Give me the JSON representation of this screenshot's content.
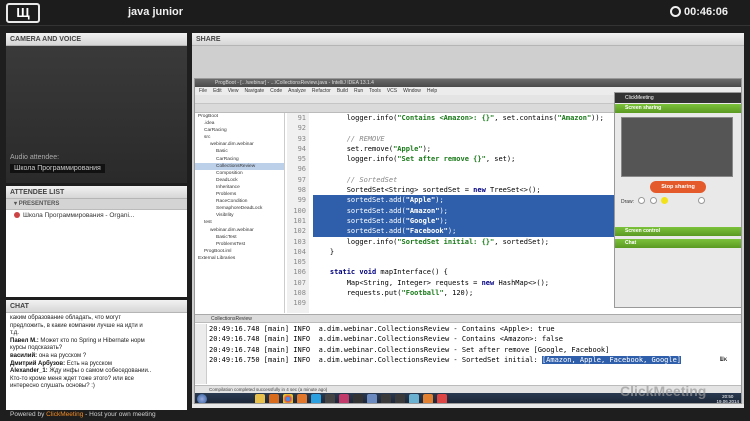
{
  "top": {
    "logo": "Щ",
    "title": "java junior",
    "timer": "00:46:06"
  },
  "camera": {
    "header": "CAMERA AND VOICE",
    "audio_label": "Audio attendee:",
    "attendee_name": "Школа Программирования"
  },
  "attendees": {
    "header": "ATTENDEE LIST",
    "sub": "PRESENTERS",
    "items": [
      "Школа Программирования - Organi..."
    ]
  },
  "chat": {
    "header": "CHAT",
    "lines": [
      {
        "user": "",
        "text": "каким образование обладать, что могут"
      },
      {
        "user": "",
        "text": "предложить, в какие компании лучше на идти и"
      },
      {
        "user": "",
        "text": "т.д."
      },
      {
        "user": "Павел М.:",
        "text": " Может кто по Spring и Hibernate норм"
      },
      {
        "user": "",
        "text": "курсы подсказать?"
      },
      {
        "user": "василий:",
        "text": " она на русском ?"
      },
      {
        "user": "Дмитрий Арбузов:",
        "text": " Есть на русском"
      },
      {
        "user": "Alexander_1:",
        "text": " Жду инфы о самом собеседовании.."
      },
      {
        "user": "",
        "text": "Кто-то кроме меня ждет тоже этого? или все"
      },
      {
        "user": "",
        "text": "интересно слушать основы? :)"
      }
    ]
  },
  "footer": {
    "prefix": "Powered by ",
    "brand": "ClickMeeting",
    "suffix": " - Host your own meeting"
  },
  "share": {
    "header": "SHARE",
    "ide_title": "ProgBoot - [...\\webinar] - ...\\CollectionsReview.java - IntelliJ IDEA 13.1.4",
    "menu": [
      "File",
      "Edit",
      "View",
      "Navigate",
      "Code",
      "Analyze",
      "Refactor",
      "Build",
      "Run",
      "Tools",
      "VCS",
      "Window",
      "Help"
    ],
    "tabs": [
      "CollectionsReview",
      "RaceCondition",
      "Deadlock",
      "SemaphoreDeadlock",
      "VisibIlity",
      "CarRacing",
      "Inheritance",
      "Problems",
      "ProblemRest"
    ],
    "tree": [
      "ProgBoot",
      ".idea",
      "CarRacing",
      "src",
      "webinar.dim.webinar",
      "Basic",
      "CarRacing",
      "CollectionsReview",
      "Composition",
      "DeadLock",
      "Inheritance",
      "Problems",
      "RaceCondition",
      "SemaphoreDeadLock",
      "VisibIlity",
      "test",
      "webinar.dim.webinar",
      "BasicTest",
      "ProblemsTest",
      "ProgBoot.iml",
      "External Libraries"
    ],
    "line_numbers": [
      "91",
      "92",
      "93",
      "94",
      "95",
      "96",
      "97",
      "98",
      "99",
      "100",
      "101",
      "102",
      "103",
      "104",
      "105",
      "106",
      "107",
      "108",
      "109"
    ],
    "run_tab": "CollectionsReview",
    "console": [
      "20:49:16.748 [main] INFO  a.dim.webinar.CollectionsReview - Contains <Apple>: true",
      "20:49:16.748 [main] INFO  a.dim.webinar.CollectionsReview - Contains <Amazon>: false",
      "20:49:16.748 [main] INFO  a.dim.webinar.CollectionsReview - Set after remove [Google, Facebook]",
      "20:49:16.750 [main] INFO  a.dim.webinar.CollectionsReview - SortedSet initial: ",
      "[Amazon, Apple, Facebook, Google]"
    ],
    "status": "Compilation completed successfully in 4 sec (a minute ago)",
    "tray_time": "20:50",
    "tray_date": "19.06.2014",
    "cursor_label": "Шк"
  },
  "clickmeeting": {
    "title": "ClickMeeting",
    "screen_sharing": "Screen sharing",
    "stop_button": "Stop sharing",
    "draw_label": "Draw:",
    "screen_control": "Screen control",
    "chat": "Chat",
    "colors": {
      "green": "#6cb02e",
      "orange": "#e55a2a",
      "dot_yellow": "#f2e21a"
    }
  },
  "watermark": "ClickMeeting"
}
